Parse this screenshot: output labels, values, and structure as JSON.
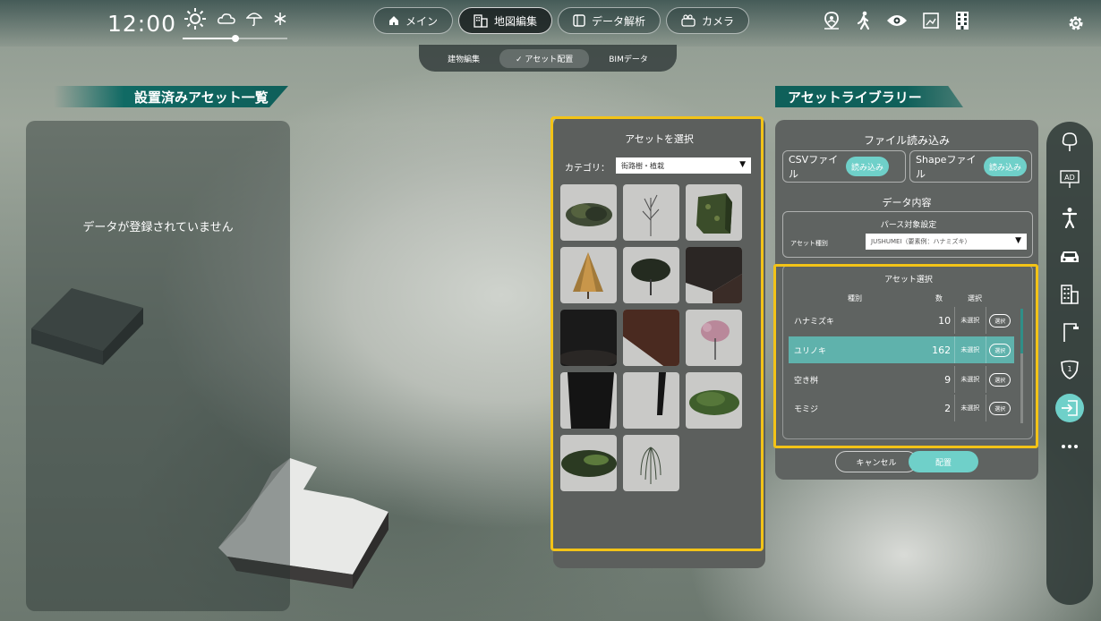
{
  "clock": "12:00",
  "weather_icons": [
    "sun-icon",
    "cloud-icon",
    "umbrella-icon",
    "snow-icon"
  ],
  "time_slider_fraction": 0.5,
  "main_tabs": [
    {
      "label": "メイン",
      "icon": "home-icon",
      "active": false
    },
    {
      "label": "地図編集",
      "icon": "building-icon",
      "active": true
    },
    {
      "label": "データ解析",
      "icon": "panel-icon",
      "active": false
    },
    {
      "label": "カメラ",
      "icon": "camera-icon",
      "active": false
    }
  ],
  "sub_tabs": [
    {
      "label": "建物編集",
      "active": false
    },
    {
      "label": "✓ アセット配置",
      "active": true
    },
    {
      "label": "BIMデータ",
      "active": false
    }
  ],
  "top_icons": [
    "location-person-icon",
    "walk-icon",
    "eye-icon",
    "capture-icon",
    "building-grid-icon"
  ],
  "left_panel": {
    "title": "設置済みアセット一覧",
    "empty_text": "データが登録されていません"
  },
  "asset_selector": {
    "title": "アセットを選択",
    "category_label": "カテゴリ：",
    "category_value": "街路樹・植栽",
    "tiles": [
      "shrub-icon",
      "bare-tree-icon",
      "hedge-icon",
      "conifer-tree-icon",
      "round-tree-icon",
      "dark-block-icon",
      "dark-cylinder-icon",
      "brick-wall-icon",
      "blossom-tree-icon",
      "dark-pillar-icon",
      "thin-pillar-icon",
      "grass-patch-icon",
      "ground-cover-icon",
      "willow-tree-icon"
    ]
  },
  "library": {
    "title": "アセットライブラリー",
    "file_section_title": "ファイル読み込み",
    "csv_label": "CSVファイル",
    "csv_button": "読み込み",
    "shape_label": "Shapeファイル",
    "shape_button": "読み込み",
    "data_title": "データ内容",
    "parse_title": "パース対象設定",
    "asset_type_label": "アセット種別",
    "asset_type_value": "JUSHUMEI（要素例：ハナミズキ）",
    "select_title": "アセット選択",
    "col_type": "種別",
    "col_count": "数",
    "col_select": "選択",
    "rows": [
      {
        "name": "ハナミズキ",
        "count": "10",
        "status": "未選択",
        "button": "選択",
        "selected": false
      },
      {
        "name": "ユリノキ",
        "count": "162",
        "status": "未選択",
        "button": "選択",
        "selected": true
      },
      {
        "name": "空き桝",
        "count": "9",
        "status": "未選択",
        "button": "選択",
        "selected": false
      },
      {
        "name": "モミジ",
        "count": "2",
        "status": "未選択",
        "button": "選択",
        "selected": false
      }
    ],
    "cancel_label": "キャンセル",
    "place_label": "配置"
  },
  "rail_icons": [
    "tree-icon",
    "ad-sign-icon",
    "person-icon",
    "car-icon",
    "building-icon",
    "street-light-icon",
    "route-sign-icon",
    "import-icon",
    "more-icon"
  ],
  "colors": {
    "accent": "#6fd0c9",
    "highlight": "#f3c317",
    "ribbon": "#106a64",
    "selected_row": "#5fb2ac"
  }
}
